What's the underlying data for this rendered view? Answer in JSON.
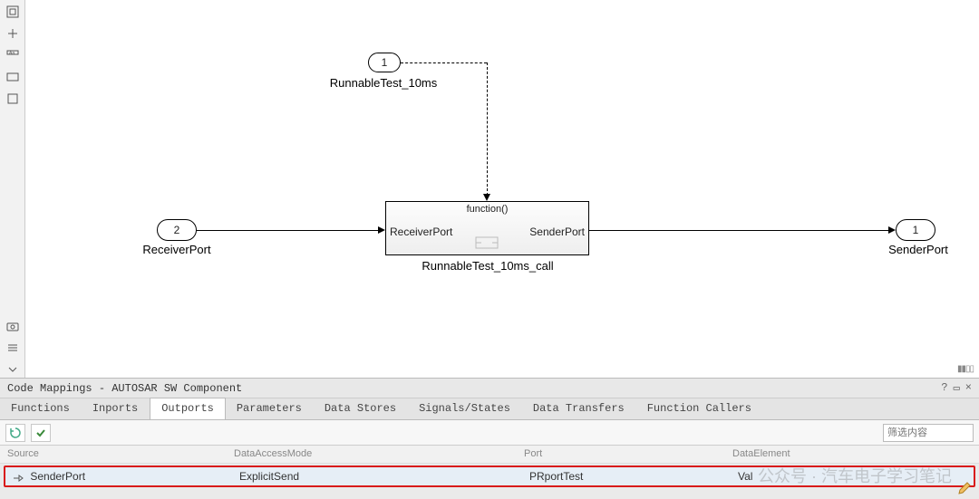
{
  "toolbar_icons": [
    "fit-icon",
    "overview-icon",
    "annotations-icon",
    "layers-icon",
    "box-icon",
    "camera-icon",
    "list-icon",
    "expand-icon"
  ],
  "diagram": {
    "inport1": {
      "number": "1",
      "label": "RunnableTest_10ms"
    },
    "inport2": {
      "number": "2",
      "label": "ReceiverPort"
    },
    "outport1": {
      "number": "1",
      "label": "SenderPort"
    },
    "function_block": {
      "header": "function()",
      "left_port": "ReceiverPort",
      "right_port": "SenderPort",
      "name": "RunnableTest_10ms_call"
    }
  },
  "panel": {
    "title": "Code Mappings - AUTOSAR SW Component",
    "tabs": [
      "Functions",
      "Inports",
      "Outports",
      "Parameters",
      "Data Stores",
      "Signals/States",
      "Data Transfers",
      "Function Callers"
    ],
    "active_tab_index": 2,
    "filter_placeholder": "筛选内容",
    "columns": [
      "Source",
      "DataAccessMode",
      "Port",
      "DataElement"
    ],
    "row": {
      "source": "SenderPort",
      "data_access_mode": "ExplicitSend",
      "port": "PRportTest",
      "data_element": "Val"
    }
  },
  "watermark": "公众号 · 汽车电子学习笔记"
}
